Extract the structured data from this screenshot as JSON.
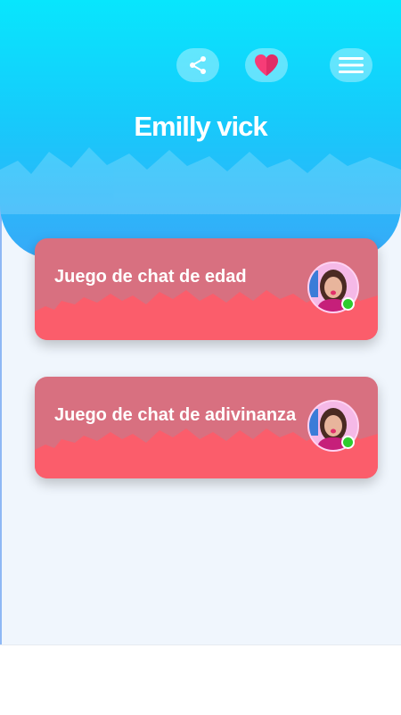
{
  "header": {
    "title": "Emilly vick",
    "share_icon": "share-icon",
    "favorite_icon": "heart-icon",
    "menu_icon": "hamburger-menu-icon"
  },
  "colors": {
    "header_top": "#08e6fd",
    "header_bottom": "#38a9f8",
    "card_top": "#d87080",
    "card_bottom": "#fb5d6b",
    "heart": "#f73c77",
    "online": "#2ecc2e",
    "background": "#f0f6fd"
  },
  "cards": [
    {
      "label": "Juego de chat de edad",
      "avatar": "profile-avatar",
      "status": "online"
    },
    {
      "label": "Juego de chat de adivinanza",
      "avatar": "profile-avatar",
      "status": "online"
    }
  ]
}
